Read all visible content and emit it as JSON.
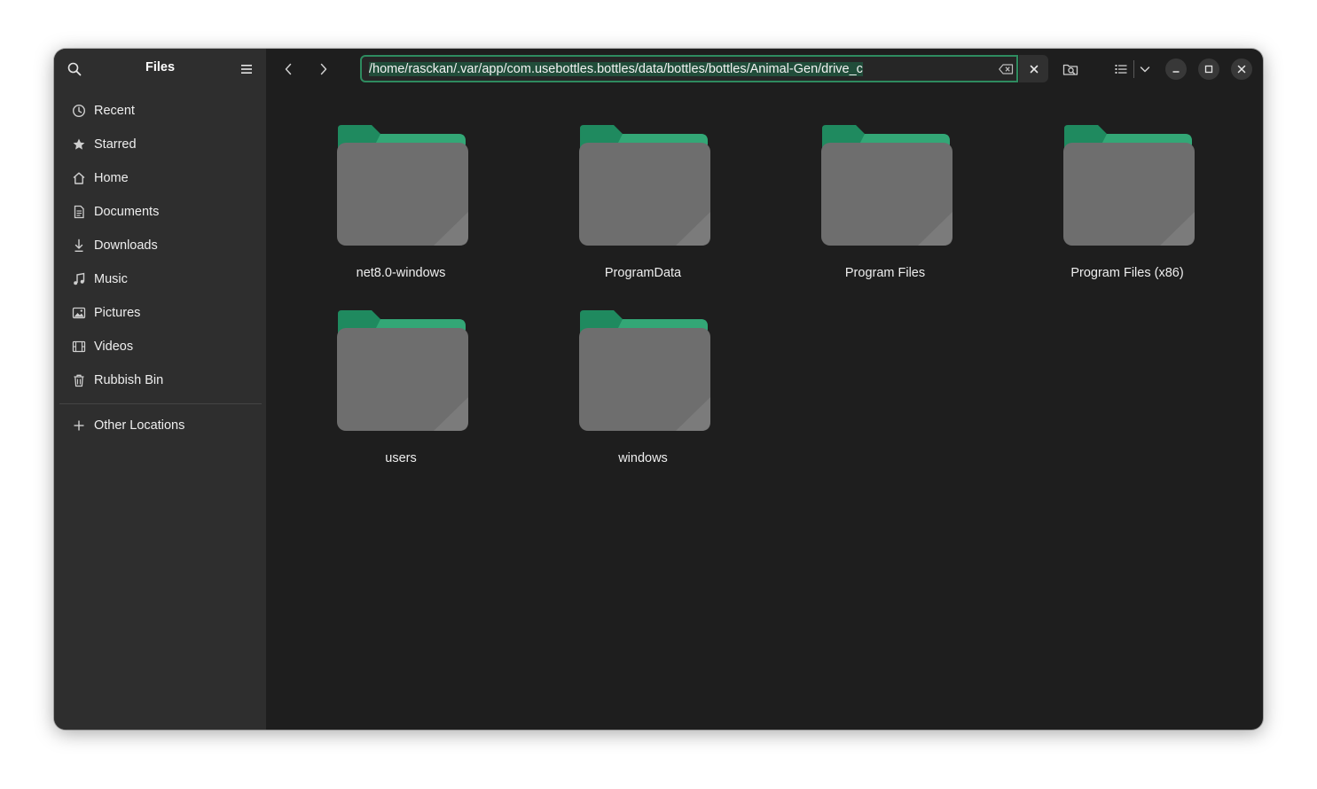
{
  "sidebar": {
    "title": "Files",
    "items": [
      {
        "label": "Recent",
        "icon": "clock-icon"
      },
      {
        "label": "Starred",
        "icon": "star-icon"
      },
      {
        "label": "Home",
        "icon": "home-icon"
      },
      {
        "label": "Documents",
        "icon": "document-icon"
      },
      {
        "label": "Downloads",
        "icon": "download-icon"
      },
      {
        "label": "Music",
        "icon": "music-icon"
      },
      {
        "label": "Pictures",
        "icon": "picture-icon"
      },
      {
        "label": "Videos",
        "icon": "film-icon"
      },
      {
        "label": "Rubbish Bin",
        "icon": "trash-icon"
      }
    ],
    "other_locations": {
      "label": "Other Locations",
      "icon": "plus-icon"
    }
  },
  "header": {
    "path": "/home/rasckan/.var/app/com.usebottles.bottles/data/bottles/bottles/Animal-Gen/drive_c"
  },
  "folders": [
    {
      "name": "net8.0-windows"
    },
    {
      "name": "ProgramData"
    },
    {
      "name": "Program Files"
    },
    {
      "name": "Program Files (x86)"
    },
    {
      "name": "users"
    },
    {
      "name": "windows"
    }
  ],
  "colors": {
    "accent": "#2e8b5f",
    "folder_tab": "#1f8a5f",
    "folder_body": "#6e6e6e"
  }
}
